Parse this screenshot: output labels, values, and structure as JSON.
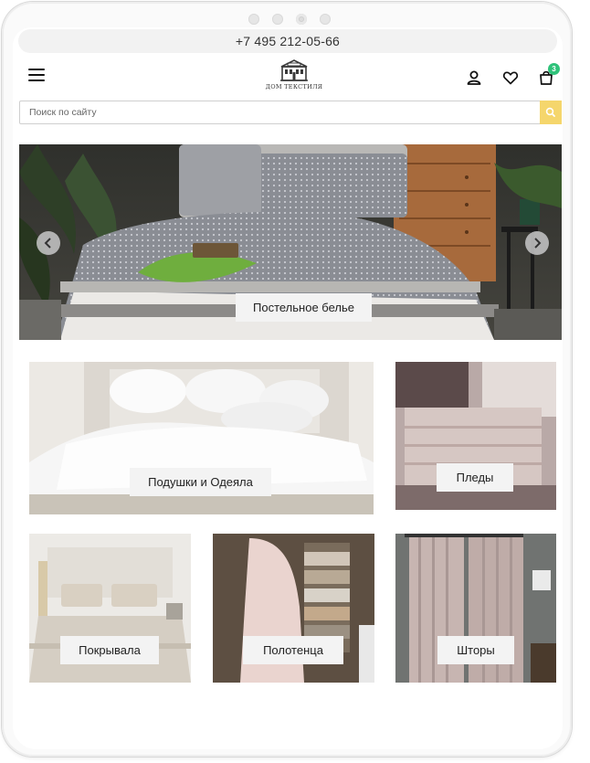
{
  "status_bar": {
    "phone": "+7 495 212-05-66"
  },
  "header": {
    "logo_text": "ДОМ ТЕКСТИЛЯ",
    "menu_icon": "hamburger-menu-icon",
    "account_icon": "user-icon",
    "wishlist_icon": "heart-icon",
    "cart_icon": "shopping-bag-icon",
    "cart_count": "3"
  },
  "search": {
    "placeholder": "Поиск по сайту",
    "button_icon": "search-icon"
  },
  "hero": {
    "label": "Постельное белье",
    "prev_icon": "chevron-left-icon",
    "next_icon": "chevron-right-icon"
  },
  "categories": [
    {
      "label": "Подушки и Одеяла"
    },
    {
      "label": "Пледы"
    },
    {
      "label": "Покрывала"
    },
    {
      "label": "Полотенца"
    },
    {
      "label": "Шторы"
    }
  ],
  "colors": {
    "accent_search": "#f5d66c",
    "badge": "#2fc27a",
    "label_bg": "#f3f3f3"
  }
}
